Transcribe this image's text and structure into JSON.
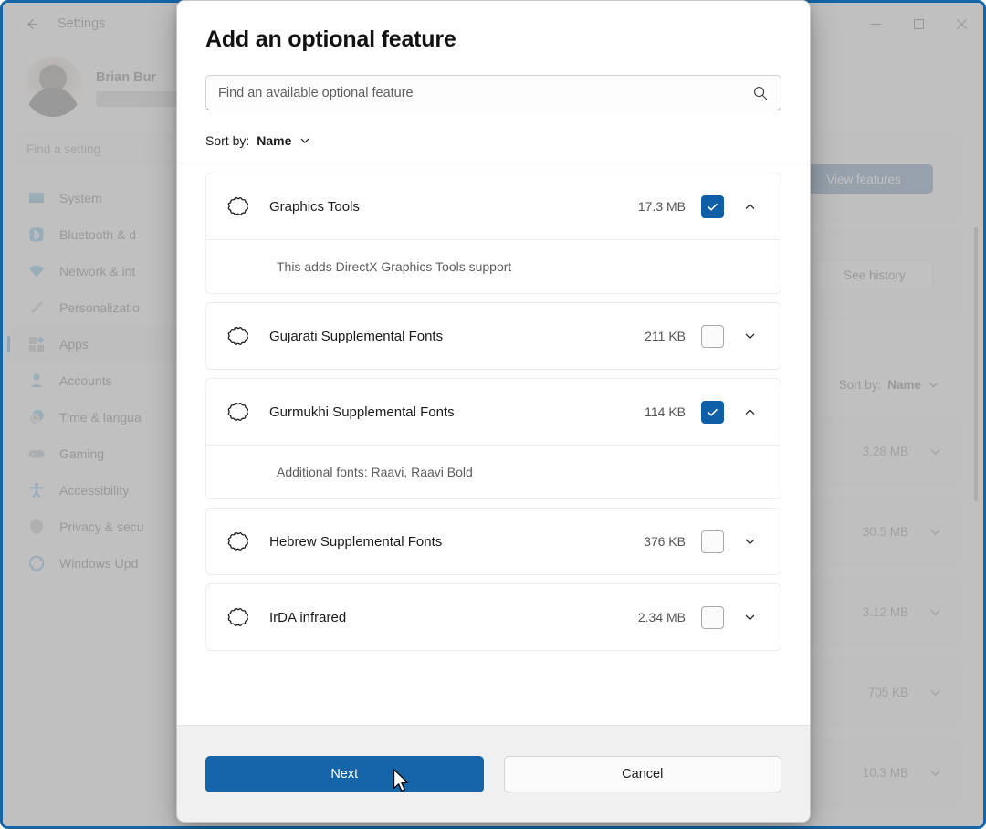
{
  "window": {
    "title": "Settings",
    "back_icon": "back-arrow-icon",
    "controls": {
      "minimize": "─",
      "maximize": "☐",
      "close": "✕"
    }
  },
  "sidebar": {
    "profile": {
      "name": "Brian Bur",
      "avatar": "user-avatar"
    },
    "search": {
      "placeholder": "Find a setting",
      "value": ""
    },
    "items": [
      {
        "label": "System",
        "icon": "monitor-icon",
        "active": false
      },
      {
        "label": "Bluetooth & d",
        "icon": "bluetooth-icon",
        "active": false
      },
      {
        "label": "Network & int",
        "icon": "wifi-icon",
        "active": false
      },
      {
        "label": "Personalizatio",
        "icon": "brush-icon",
        "active": false
      },
      {
        "label": "Apps",
        "icon": "apps-icon",
        "active": true
      },
      {
        "label": "Accounts",
        "icon": "person-icon",
        "active": false
      },
      {
        "label": "Time & langua",
        "icon": "clock-icon",
        "active": false
      },
      {
        "label": "Gaming",
        "icon": "gamepad-icon",
        "active": false
      },
      {
        "label": "Accessibility",
        "icon": "accessibility-icon",
        "active": false
      },
      {
        "label": "Privacy & secu",
        "icon": "shield-icon",
        "active": false
      },
      {
        "label": "Windows Upd",
        "icon": "update-icon",
        "active": false
      }
    ]
  },
  "background_content": {
    "view_features_label": "View features",
    "see_history_label": "See history",
    "sort_prefix": "Sort by:",
    "sort_value": "Name",
    "installed_sizes": [
      "3.28 MB",
      "30.5 MB",
      "3.12 MB",
      "705 KB",
      "10.3 MB"
    ]
  },
  "dialog": {
    "title": "Add an optional feature",
    "search": {
      "placeholder": "Find an available optional feature",
      "value": "",
      "icon": "search-icon"
    },
    "sort": {
      "prefix": "Sort by:",
      "value": "Name",
      "icon": "chevron-down-icon"
    },
    "features": [
      {
        "name": "Graphics Tools",
        "size": "17.3 MB",
        "checked": true,
        "expanded": true,
        "description": "This adds DirectX Graphics Tools support",
        "icon": "optional-feature-icon"
      },
      {
        "name": "Gujarati Supplemental Fonts",
        "size": "211 KB",
        "checked": false,
        "expanded": false,
        "description": "",
        "icon": "optional-feature-icon"
      },
      {
        "name": "Gurmukhi Supplemental Fonts",
        "size": "114 KB",
        "checked": true,
        "expanded": true,
        "description": "Additional fonts: Raavi, Raavi Bold",
        "icon": "optional-feature-icon"
      },
      {
        "name": "Hebrew Supplemental Fonts",
        "size": "376 KB",
        "checked": false,
        "expanded": false,
        "description": "",
        "icon": "optional-feature-icon"
      },
      {
        "name": "IrDA infrared",
        "size": "2.34 MB",
        "checked": false,
        "expanded": false,
        "description": "",
        "icon": "optional-feature-icon"
      }
    ],
    "next_label": "Next",
    "cancel_label": "Cancel"
  },
  "colors": {
    "accent": "#1565a8",
    "accent_dark": "#0f4b86",
    "checkbox_on": "#0f5fa8",
    "dialog_bg": "#ffffff",
    "footer_bg": "#f0f0f0"
  }
}
